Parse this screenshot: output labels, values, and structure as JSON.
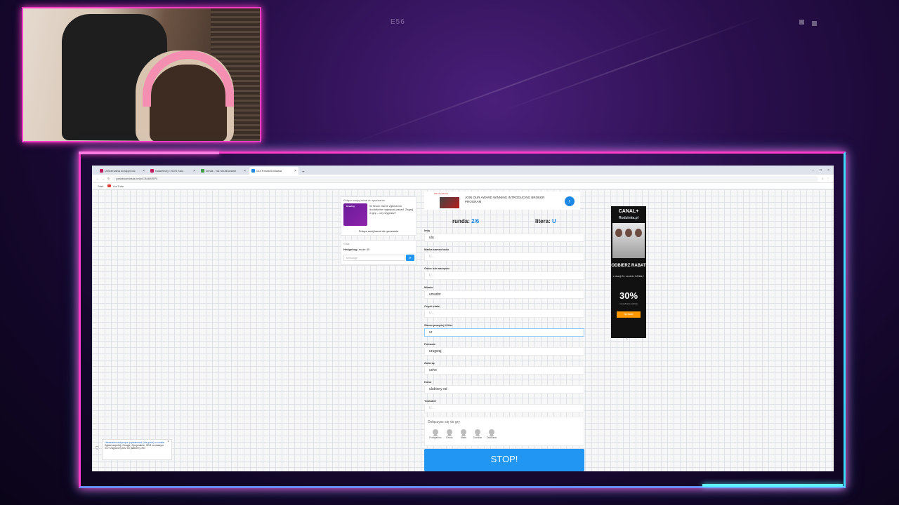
{
  "overlay": {
    "code": "E56"
  },
  "browser": {
    "tabs": [
      {
        "label": "Uniwersalna dostępność",
        "active": false
      },
      {
        "label": "Kalambury • SOS Kalu",
        "active": false
      },
      {
        "label": "Gmail - N& Skutkowanie",
        "active": false
      },
      {
        "label": "Gra Państwa Miasta",
        "active": true
      }
    ],
    "url": "panstwamiasta.net/y/CB4AMSP0",
    "bookmarks": [
      "Start",
      "YouTube"
    ]
  },
  "promo": {
    "title": "Połącz swoją kanał do rysowania",
    "image_label": "Drawing",
    "text": "W Show Game zgłoszono dodatkowe najwięcej zasad. Zagraj w grę – czy wygrasz?",
    "link": "Połącz swój kanał do rysowania"
  },
  "chat": {
    "header": "Chat",
    "author": "Hedgehog",
    "message": "może 40",
    "placeholder": "Message",
    "send_icon": "send-icon"
  },
  "game_ad": {
    "thumb_label": "Winning Broker",
    "text": "JOIN OUR AWARD WINNING INTRODUCING BROKER PROGRAM",
    "arrow": "›"
  },
  "game": {
    "round_label": "runda:",
    "round_value": "2/6",
    "letter_label": "litera:",
    "letter_value": "U",
    "fields": [
      {
        "label": "Imię",
        "value": "ula",
        "placeholder": false
      },
      {
        "label": "Marka samochodu",
        "value": "U...",
        "placeholder": true
      },
      {
        "label": "Owoc lub warzywo",
        "value": "U...",
        "placeholder": true
      },
      {
        "label": "Miasto",
        "value": "umador",
        "placeholder": false
      },
      {
        "label": "Część ciała",
        "value": "U...",
        "placeholder": true
      },
      {
        "label": "Słowo powyżej 4 liter",
        "value": "ur",
        "placeholder": false,
        "focused": true
      },
      {
        "label": "Potrawa",
        "value": "urugwaj",
        "placeholder": false
      },
      {
        "label": "Zwierzę",
        "value": "ucho",
        "placeholder": false
      },
      {
        "label": "Kolor",
        "value": "ulubiony ed",
        "placeholder": false
      },
      {
        "label": "Youtuber",
        "value": "U...",
        "placeholder": true
      }
    ],
    "players_title": "Dołączysz się do gry",
    "players": [
      "Postgarlinc",
      "Brook",
      "Maks",
      "Dundee",
      "OddNeck"
    ],
    "stop_label": "STOP!"
  },
  "canal_ad": {
    "logo": "CANAL+",
    "subtitle": "Rodzinka.pl",
    "headline": "ODBIERZ RABAT",
    "small": "z okazji 24. urodzin CANAL+",
    "percent": "30%",
    "percent_sub": "na wybrane pakiety",
    "button": "Sprawdź"
  },
  "toast": {
    "link": "Ustawienia dotyczące prywatności (dla gości) w cookie",
    "text": "Zgłoś/uzupełnij. Google, Opcjonalnie, SDS na naszym CCT zagrożony bez 15 platformy XID",
    "close": "×"
  },
  "colors": {
    "accent": "#2196f3",
    "neon_pink": "#ff3cc7",
    "neon_cyan": "#38d8ff"
  }
}
